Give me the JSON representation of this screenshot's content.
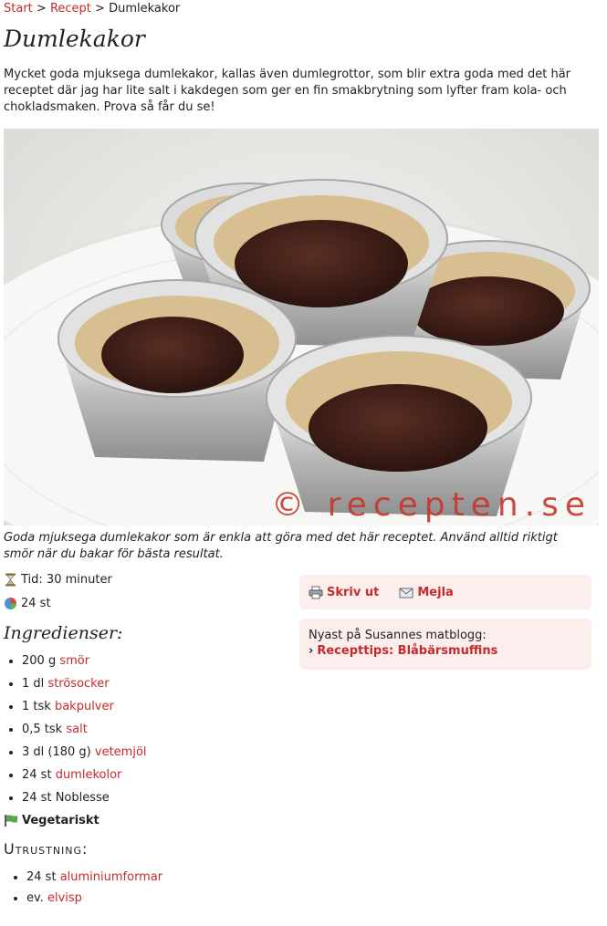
{
  "breadcrumb": {
    "home": "Start",
    "section": "Recept",
    "sep": ">",
    "current": "Dumlekakor"
  },
  "page": {
    "title": "Dumlekakor",
    "intro": "Mycket goda mjuksega dumlekakor, kallas även dumlegrottor, som blir extra goda med det här receptet där jag har lite salt i kakdegen som ger en fin smakbrytning som lyfter fram kola- och chokladsmaken. Prova så får du se!",
    "image_watermark": "© recepten.se",
    "caption": "Goda mjuksega dumlekakor som är enkla att göra med det här receptet. Använd alltid riktigt smör när du bakar för bästa resultat."
  },
  "meta": {
    "time": "Tid: 30 minuter",
    "servings": "24 st",
    "time_icon": "hourglass-icon",
    "servings_icon": "pie-chart-icon"
  },
  "ingredients": {
    "title": "Ingredienser:",
    "items": [
      {
        "amount": "200 g",
        "name": "smör"
      },
      {
        "amount": "1 dl",
        "name": "strösocker"
      },
      {
        "amount": "1 tsk",
        "name": "bakpulver"
      },
      {
        "amount": "0,5 tsk",
        "name": "salt"
      },
      {
        "amount": "3 dl (180 g)",
        "name": "vetemjöl"
      },
      {
        "amount": "24 st",
        "name": "dumlekolor"
      },
      {
        "amount": "24 st",
        "plain": "Noblesse"
      }
    ]
  },
  "vegetarian": "Vegetariskt",
  "equipment": {
    "title": "Utrustning:",
    "items": [
      {
        "amount": "24 st",
        "name": "aluminiumformar"
      },
      {
        "amount": "ev.",
        "name": "elvisp"
      }
    ]
  },
  "actions": {
    "print": "Skriv ut",
    "mail": "Mejla"
  },
  "blog": {
    "text": "Nyast på Susannes matblogg:",
    "link": "Recepttips: Blåbärsmuffins"
  },
  "colors": {
    "link": "#c62b2b",
    "box_bg": "#fdeeee"
  }
}
